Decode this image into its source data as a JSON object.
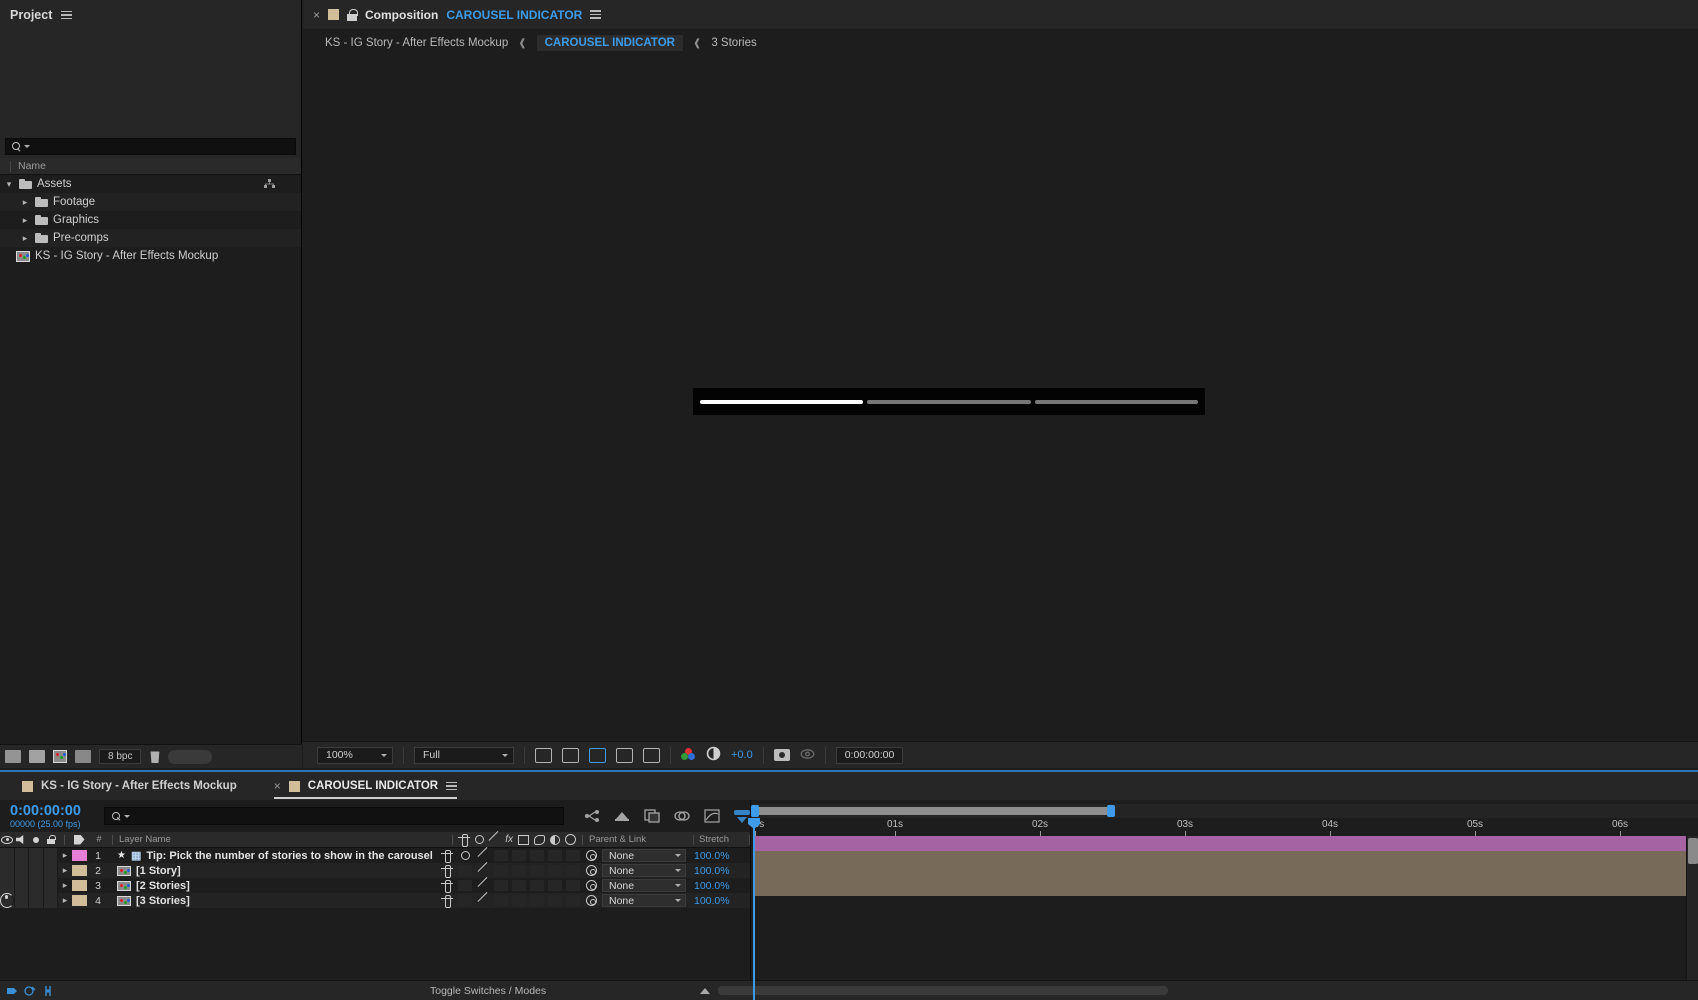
{
  "project": {
    "title": "Project",
    "menu_icon": "hamburger-icon",
    "search_placeholder": "",
    "column_header": "Name",
    "items": [
      {
        "label": "Assets",
        "type": "folder",
        "depth": 0,
        "expanded": true
      },
      {
        "label": "Footage",
        "type": "folder",
        "depth": 1,
        "expanded": false
      },
      {
        "label": "Graphics",
        "type": "folder",
        "depth": 1,
        "expanded": false
      },
      {
        "label": "Pre-comps",
        "type": "folder",
        "depth": 1,
        "expanded": false
      },
      {
        "label": "KS - IG Story - After Effects Mockup",
        "type": "composition",
        "depth": 0,
        "expanded": false
      }
    ],
    "footer": {
      "new_footage_icon": "interpret-footage-icon",
      "new_folder_icon": "new-folder-icon",
      "new_comp_icon": "new-composition-icon",
      "project_settings_icon": "project-settings-icon",
      "bit_depth": "8 bpc",
      "delete_icon": "trash-icon"
    }
  },
  "composition": {
    "tab": {
      "close_icon": "close-icon",
      "swatch_color": "#d1bd9a",
      "lock_icon": "lock-icon",
      "panel_label": "Composition",
      "comp_name": "CAROUSEL INDICATOR",
      "menu_icon": "hamburger-icon"
    },
    "breadcrumb": [
      {
        "label": "KS - IG Story - After Effects Mockup",
        "active": false
      },
      {
        "label": "CAROUSEL INDICATOR",
        "active": true
      },
      {
        "label": "3 Stories",
        "active": false
      }
    ],
    "canvas": {
      "carousel_segments": [
        {
          "name": "story-1-segment",
          "fill": "#ffffff",
          "state": "active"
        },
        {
          "name": "story-2-segment",
          "fill": "#767676",
          "state": "inactive"
        },
        {
          "name": "story-3-segment",
          "fill": "#767676",
          "state": "inactive"
        }
      ],
      "background": "#030303"
    },
    "bottom_bar": {
      "zoom": "100%",
      "resolution": "Full",
      "fast_preview_icon": "fast-preview-icon",
      "transparency_grid_icon": "transparency-grid-icon",
      "region_of_interest_icon": "region-of-interest-icon",
      "mask_icon": "toggle-mask-icon",
      "proportional_grid_icon": "proportional-grid-icon",
      "channel_icon": "show-channel-icon",
      "exposure_icon": "exposure-icon",
      "exposure_value": "+0.0",
      "snapshot_icon": "take-snapshot-icon",
      "show_snapshot_icon": "show-snapshot-icon",
      "timecode": "0:00:00:00"
    }
  },
  "timeline": {
    "tabs": [
      {
        "label": "KS - IG Story - After Effects Mockup",
        "active": false,
        "swatch": "#d1bd9a"
      },
      {
        "label": "CAROUSEL INDICATOR",
        "active": true,
        "swatch": "#d1bd9a"
      }
    ],
    "menu_icon": "hamburger-icon",
    "close_icon": "close-icon",
    "current_time": "0:00:00:00",
    "frame_info": "00000 (25.00 fps)",
    "search_placeholder": "",
    "toolbar_icons": [
      "composition-mini-flowchart-icon",
      "draft-3d-icon",
      "hide-shy-layers-icon",
      "enable-frame-blending-icon",
      "motion-blur-icon",
      "graph-editor-icon"
    ],
    "column_headers": {
      "video_icon": "eye-icon",
      "audio_icon": "speaker-icon",
      "solo_icon": "solo-icon",
      "lock_icon": "lock-icon",
      "label_icon": "label-tag-icon",
      "index": "#",
      "layer_name": "Layer Name",
      "switches": [
        "shy-icon",
        "collapse-icon",
        "quality-icon",
        "effects-icon",
        "frame-blend-icon",
        "motion-blur-icon",
        "adjustment-icon",
        "3d-layer-icon"
      ],
      "parent_and_link": "Parent & Link",
      "stretch": "Stretch"
    },
    "layers": [
      {
        "index": "1",
        "name": "Tip: Pick the number of stories to show in the carousel",
        "label_color": "#e87fd6",
        "bar_color": "#a563a3",
        "icons": [
          "star-icon",
          "grid-icon"
        ],
        "visible": false,
        "parent": "None",
        "stretch": "100.0%"
      },
      {
        "index": "2",
        "name": "[1 Story]",
        "label_color": "#d1bd9a",
        "bar_color": "#776a59",
        "icons": [
          "composition-icon"
        ],
        "visible": false,
        "parent": "None",
        "stretch": "100.0%"
      },
      {
        "index": "3",
        "name": "[2 Stories]",
        "label_color": "#d1bd9a",
        "bar_color": "#776a59",
        "icons": [
          "composition-icon"
        ],
        "visible": false,
        "parent": "None",
        "stretch": "100.0%"
      },
      {
        "index": "4",
        "name": "[3 Stories]",
        "label_color": "#d1bd9a",
        "bar_color": "#776a59",
        "icons": [
          "composition-icon"
        ],
        "visible": true,
        "parent": "None",
        "stretch": "100.0%"
      }
    ],
    "ruler": {
      "ticks": [
        "0s",
        "01s",
        "02s",
        "03s",
        "04s",
        "05s",
        "06s"
      ],
      "work_area_start": "0s",
      "work_area_end": "03s"
    },
    "status_bar": {
      "toggle_label": "Toggle Switches / Modes",
      "icons": [
        "layer-switches-icon",
        "transfer-controls-icon",
        "split-view-icon"
      ],
      "zoom_out_icon": "zoom-out-icon",
      "zoom_in_icon": "zoom-in-icon"
    }
  },
  "colors": {
    "accent_blue": "#3d9be9",
    "panel_bg": "#1d1d1d",
    "header_bg": "#262626",
    "label_tan": "#d1bd9a",
    "label_pink": "#e87fd6"
  }
}
